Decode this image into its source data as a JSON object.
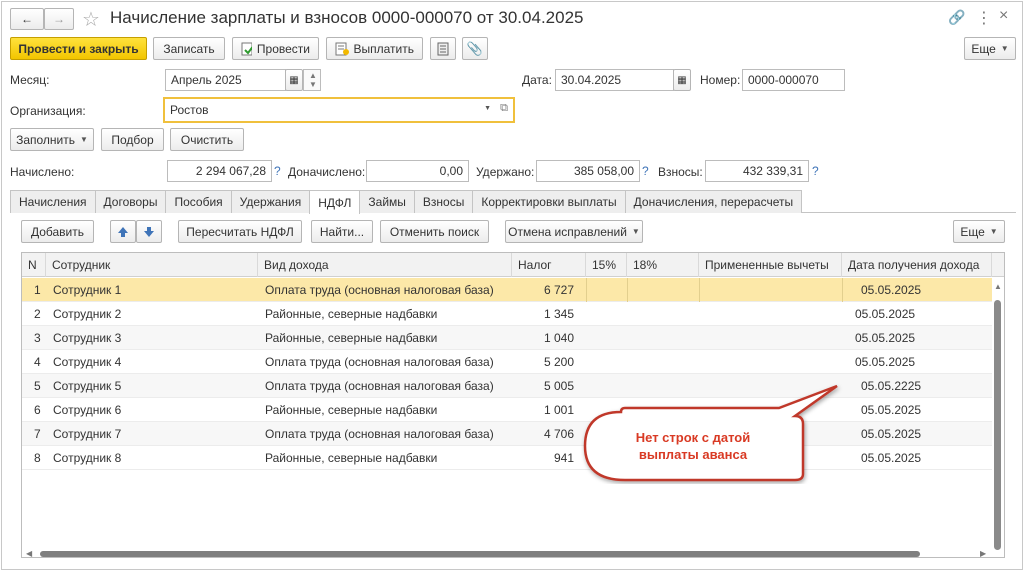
{
  "title": "Начисление зарплаты и взносов 0000-000070 от 30.04.2025",
  "toolbar": {
    "post_close": "Провести и закрыть",
    "save": "Записать",
    "post": "Провести",
    "pay": "Выплатить",
    "more": "Еще"
  },
  "form": {
    "month_label": "Месяц:",
    "month_value": "Апрель 2025",
    "date_label": "Дата:",
    "date_value": "30.04.2025",
    "number_label": "Номер:",
    "number_value": "0000-000070",
    "org_label": "Организация:",
    "org_value": "Ростов",
    "fill": "Заполнить",
    "pick": "Подбор",
    "clear": "Очистить"
  },
  "totals": {
    "accrued_label": "Начислено:",
    "accrued": "2 294 067,28",
    "extra_label": "Доначислено:",
    "extra": "0,00",
    "withheld_label": "Удержано:",
    "withheld": "385 058,00",
    "contrib_label": "Взносы:",
    "contrib": "432 339,31",
    "help": "?"
  },
  "tabs": [
    "Начисления",
    "Договоры",
    "Пособия",
    "Удержания",
    "НДФЛ",
    "Займы",
    "Взносы",
    "Корректировки выплаты",
    "Доначисления, перерасчеты"
  ],
  "active_tab": "НДФЛ",
  "grid_toolbar": {
    "add": "Добавить",
    "recalc": "Пересчитать НДФЛ",
    "find": "Найти...",
    "cancel_search": "Отменить поиск",
    "corrections": "Отмена исправлений",
    "more": "Еще"
  },
  "table": {
    "columns": [
      "N",
      "Сотрудник",
      "Вид дохода",
      "Налог",
      "15%",
      "18%",
      "Примененные вычеты",
      "Дата получения дохода"
    ],
    "rows": [
      {
        "n": "1",
        "employee": "Сотрудник 1",
        "income": "Оплата труда (основная налоговая база)",
        "tax": "6 727",
        "date": "05.05.2025"
      },
      {
        "n": "2",
        "employee": "Сотрудник 2",
        "income": "Районные, северные надбавки",
        "tax": "1 345",
        "date": "05.05.2025"
      },
      {
        "n": "3",
        "employee": "Сотрудник 3",
        "income": "Районные, северные надбавки",
        "tax": "1 040",
        "date": "05.05.2025"
      },
      {
        "n": "4",
        "employee": "Сотрудник 4",
        "income": "Оплата труда (основная налоговая база)",
        "tax": "5 200",
        "date": "05.05.2025"
      },
      {
        "n": "5",
        "employee": "Сотрудник 5",
        "income": "Оплата труда (основная налоговая база)",
        "tax": "5 005",
        "date": "05.05.2225"
      },
      {
        "n": "6",
        "employee": "Сотрудник 6",
        "income": "Районные, северные надбавки",
        "tax": "1 001",
        "date": "05.05.2025"
      },
      {
        "n": "7",
        "employee": "Сотрудник 7",
        "income": "Оплата труда (основная налоговая база)",
        "tax": "4 706",
        "date": "05.05.2025"
      },
      {
        "n": "8",
        "employee": "Сотрудник 8",
        "income": "Районные, северные надбавки",
        "tax": "941",
        "date": "05.05.2025"
      }
    ]
  },
  "callout": "Нет строк с датой выплаты аванса",
  "colors": {
    "accent": "#f2c500",
    "selected_row": "#fce8a8",
    "callout": "#d93a24",
    "link": "#3f74b8"
  }
}
